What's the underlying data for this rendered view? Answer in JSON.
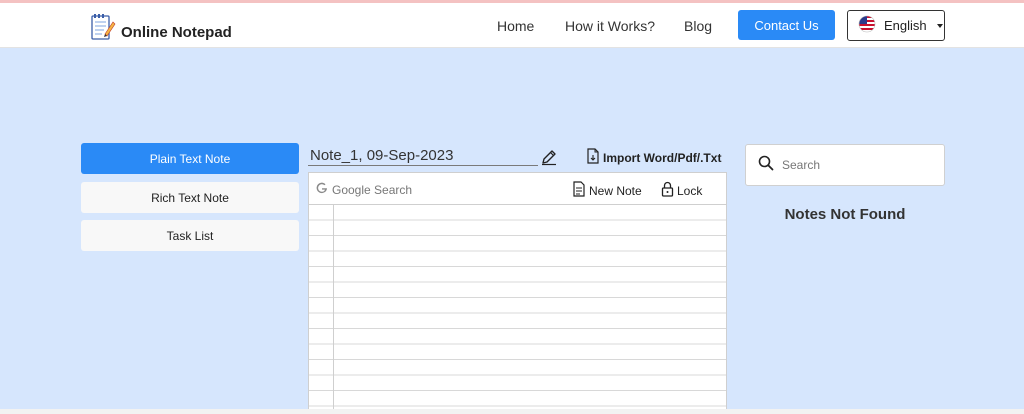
{
  "brand": {
    "name": "Online Notepad",
    "icon": "notepad-icon"
  },
  "nav": {
    "links": [
      "Home",
      "How it Works?",
      "Blog"
    ],
    "contact_label": "Contact Us",
    "language": {
      "label": "English",
      "icon": "us-flag-icon"
    }
  },
  "sidebar": {
    "buttons": [
      {
        "label": "Plain Text Note",
        "active": true
      },
      {
        "label": "Rich Text Note",
        "active": false
      },
      {
        "label": "Task List",
        "active": false
      }
    ]
  },
  "note": {
    "title": "Note_1, 09-Sep-2023",
    "import_label": "Import Word/Pdf/.Txt",
    "toolbar": {
      "google_search": "Google Search",
      "new_note": "New Note",
      "lock": "Lock"
    }
  },
  "notes_panel": {
    "search_placeholder": "Search",
    "empty_message": "Notes Not Found"
  },
  "colors": {
    "accent": "#2a8af6",
    "background": "#d6e6fd"
  }
}
